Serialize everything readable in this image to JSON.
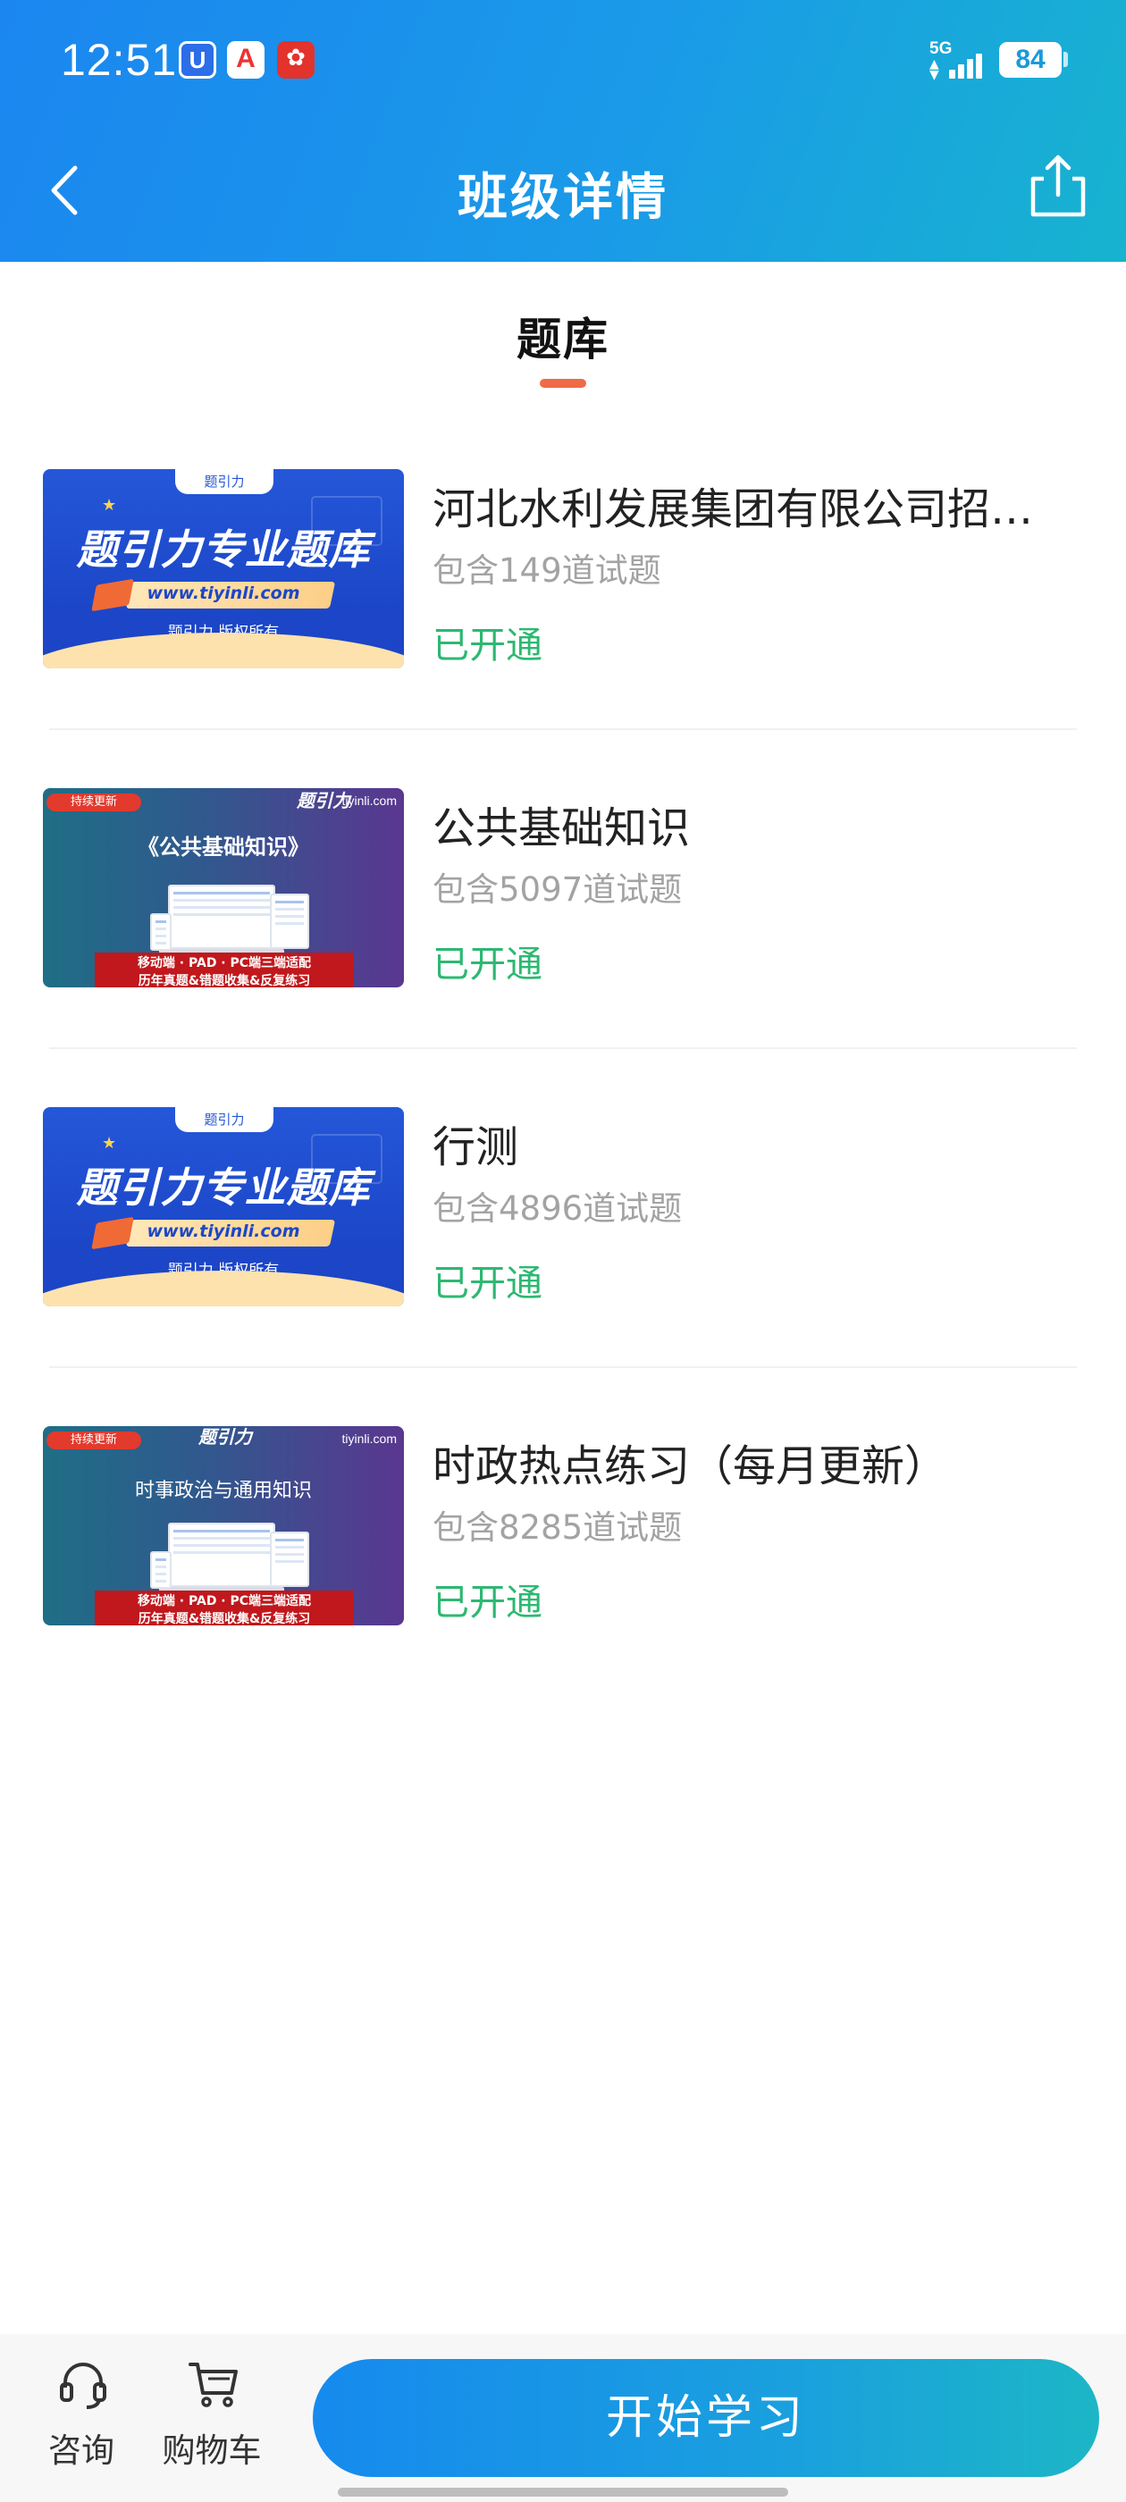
{
  "status_bar": {
    "time": "12:51",
    "network": "5G",
    "battery": "84"
  },
  "nav": {
    "title": "班级详情",
    "back_icon": "chevron-left-icon",
    "share_icon": "share-icon"
  },
  "tabs": [
    {
      "label": "题库",
      "active": true
    }
  ],
  "thumb_text": {
    "promo_headline": "题引力专业题库",
    "promo_url": "www.tiyinli.com",
    "promo_copyright": "题引力 版权所有",
    "promo_tag": "题引力",
    "badge": "持续更新",
    "logo": "题引力",
    "site": "tiyinli.com",
    "subject_1": "《公共基础知识》",
    "subject_2": "时事政治与通用知识",
    "panel_line1": "移动端 · PAD · PC端三端适配",
    "panel_line2": "历年真题&错题收集&反复练习"
  },
  "items": [
    {
      "title": "河北水利发展集团有限公司招…",
      "count": "包含149道试题",
      "status": "已开通"
    },
    {
      "title": "公共基础知识",
      "count": "包含5097道试题",
      "status": "已开通"
    },
    {
      "title": "行测",
      "count": "包含4896道试题",
      "status": "已开通"
    },
    {
      "title": "时政热点练习（每月更新）",
      "count": "包含8285道试题",
      "status": "已开通"
    }
  ],
  "bottom_bar": {
    "consult_label": "咨询",
    "consult_icon": "headset-icon",
    "cart_label": "购物车",
    "cart_icon": "cart-icon",
    "start_button": "开始学习"
  },
  "colors": {
    "header_gradient_start": "#1b86f0",
    "header_gradient_end": "#17b3cf",
    "tab_indicator": "#ef6a47",
    "status_green": "#2db872",
    "muted_text": "#a3a3a3"
  }
}
